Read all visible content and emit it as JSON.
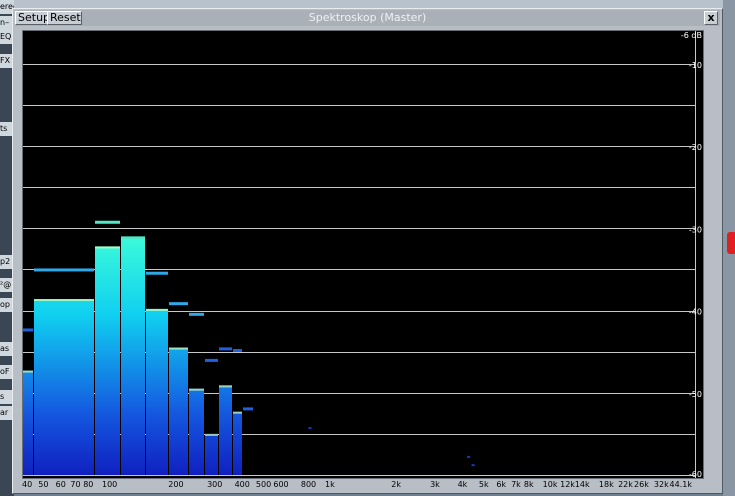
{
  "window": {
    "title": "Spektroskop (Master)",
    "setup_label": "Setup",
    "reset_label": "Reset",
    "close_label": "x"
  },
  "background": {
    "left_labels": [
      "ereo",
      "n–",
      "EQ",
      "FX",
      "ts",
      "p2",
      "²@",
      "op",
      "as",
      "oF",
      "s",
      "ar"
    ]
  },
  "colors": {
    "plot_bg": "#000000",
    "grid": "#c8c8c8",
    "bar_top": "#40ffd8",
    "bar_bottom": "#1020c0",
    "peak": "#50e8c8"
  },
  "chart_data": {
    "type": "bar",
    "title": "Spektroskop (Master)",
    "x_scale": "log",
    "xlim": [
      40,
      44100
    ],
    "x_tick_labels": [
      "40",
      "50",
      "60",
      "70",
      "80",
      "100",
      "200",
      "300",
      "400",
      "500",
      "600",
      "800",
      "1k",
      "2k",
      "3k",
      "4k",
      "5k",
      "6k",
      "7k",
      "8k",
      "10k",
      "12k",
      "14k",
      "18k",
      "22k",
      "26k",
      "32k",
      "44.1k"
    ],
    "x_tick_values": [
      40,
      50,
      60,
      70,
      80,
      100,
      200,
      300,
      400,
      500,
      600,
      800,
      1000,
      2000,
      3000,
      4000,
      5000,
      6000,
      7000,
      8000,
      10000,
      12000,
      14000,
      18000,
      22000,
      26000,
      32000,
      44100
    ],
    "ylim": [
      -60,
      -6
    ],
    "y_tick_labels": [
      "-6 dB",
      "-10",
      "-20",
      "-30",
      "-40",
      "-50",
      "-60"
    ],
    "y_tick_values": [
      -6,
      -10,
      -20,
      -30,
      -40,
      -50,
      -60
    ],
    "grid_db": [
      -10,
      -15,
      -20,
      -25,
      -30,
      -35,
      -40,
      -45,
      -50,
      -55,
      -60
    ],
    "bars": [
      {
        "f0": 40,
        "f1": 45,
        "value": -47.3,
        "peak": -42.3
      },
      {
        "f0": 45,
        "f1": 85,
        "value": -38.6,
        "peak": -35.0
      },
      {
        "f0": 85,
        "f1": 112,
        "value": -32.2,
        "peak": -29.2
      },
      {
        "f0": 112,
        "f1": 145,
        "value": -31.1,
        "peak": -31.1
      },
      {
        "f0": 145,
        "f1": 185,
        "value": -39.8,
        "peak": -35.4
      },
      {
        "f0": 185,
        "f1": 228,
        "value": -44.5,
        "peak": -39.1
      },
      {
        "f0": 228,
        "f1": 268,
        "value": -49.5,
        "peak": -40.4
      },
      {
        "f0": 268,
        "f1": 310,
        "value": -55.0,
        "peak": -46.0
      },
      {
        "f0": 310,
        "f1": 360,
        "value": -49.1,
        "peak": -44.6
      },
      {
        "f0": 360,
        "f1": 400,
        "value": -52.3,
        "peak": -44.8
      },
      {
        "f0": 400,
        "f1": 450,
        "value": -60,
        "peak": -51.9
      }
    ],
    "low_marks": [
      {
        "f": 800,
        "value": -54.3
      },
      {
        "f": 4200,
        "value": -57.8
      },
      {
        "f": 4400,
        "value": -58.8
      }
    ]
  }
}
